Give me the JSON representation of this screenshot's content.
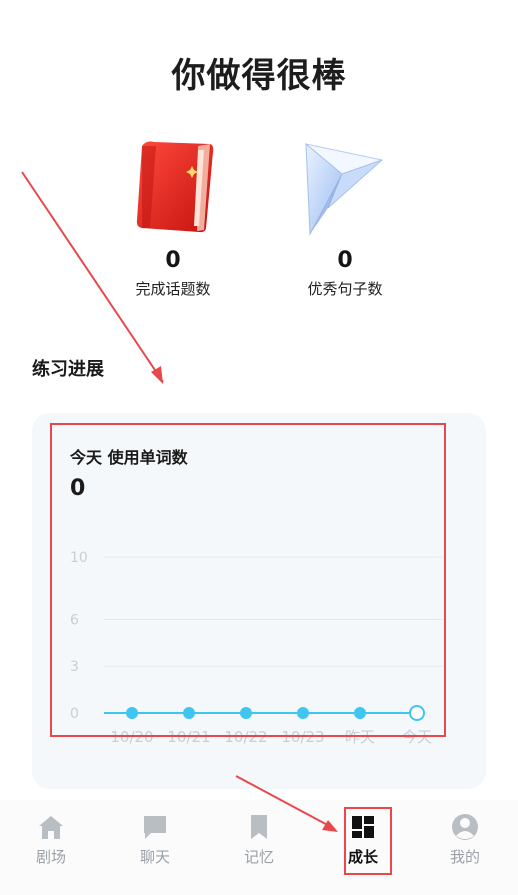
{
  "header": {
    "title": "你做得很棒"
  },
  "stats": [
    {
      "value": "0",
      "label": "完成话题数",
      "icon": "red-book-icon"
    },
    {
      "value": "0",
      "label": "优秀句子数",
      "icon": "paper-plane-icon"
    }
  ],
  "progress": {
    "section_title": "练习进展",
    "card_title": "今天 使用单词数",
    "card_value": "0"
  },
  "chart_data": {
    "type": "line",
    "title": "今天 使用单词数",
    "categories": [
      "10/20",
      "10/21",
      "10/22",
      "10/23",
      "昨天",
      "今天"
    ],
    "series": [
      {
        "values": [
          0,
          0,
          0,
          0,
          0,
          0
        ]
      }
    ],
    "y_ticks": [
      "10",
      "6",
      "3",
      "0"
    ],
    "ylim": [
      0,
      10
    ],
    "grid": true,
    "line_color": "#3fc6f0",
    "last_point_hollow": true
  },
  "tabbar": {
    "items": [
      {
        "label": "剧场",
        "icon": "home-icon",
        "active": false
      },
      {
        "label": "聊天",
        "icon": "chat-icon",
        "active": false
      },
      {
        "label": "记忆",
        "icon": "bookmark-icon",
        "active": false
      },
      {
        "label": "成长",
        "icon": "dashboard-icon",
        "active": true
      },
      {
        "label": "我的",
        "icon": "profile-icon",
        "active": false
      }
    ]
  },
  "colors": {
    "annotation": "#e8484c",
    "chart_line": "#3fc6f0",
    "tab_inactive": "#b9bec3",
    "tab_active": "#111111",
    "card_bg": "#f4f8fb"
  }
}
